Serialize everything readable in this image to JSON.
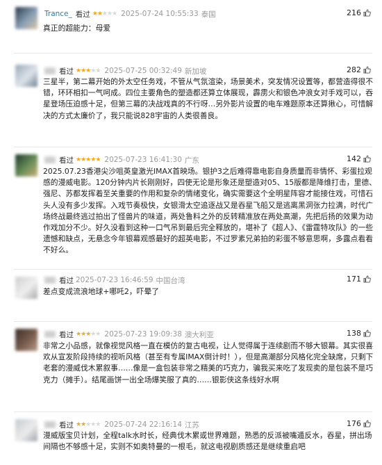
{
  "reviews": [
    {
      "username": "Trance_",
      "username_blurred": false,
      "action": "看过",
      "rating": 2,
      "datetime": "2025-07-24 10:55:33",
      "location": "泰国",
      "votes": "216",
      "text": "真正的超能力：母爱"
    },
    {
      "username": "",
      "username_blurred": true,
      "action": "看过",
      "rating": 3,
      "datetime": "2025-07-25 00:32:49",
      "location": "新加坡",
      "votes": "282",
      "text": "三星半，第二幕开始的外太空任务戏，不管从气氛渲染，场景美术，突发情况设置等，都营造得很不错，环环相扣一气呵成。四位主要角色的塑造都还算立体展现，霹雳火和银色冲浪女对手戏可以，吞星登场压迫感十足，但第三幕的决战戏真的不行呀…另外影片设置的电车难题原本还算揪心，可惜解决的方式太廉价了，我只能说828宇宙的人类很善良。"
    },
    {
      "username": "",
      "username_blurred": true,
      "action": "看过",
      "rating": 5,
      "datetime": "2025-07-23 16:41:30",
      "location": "广东",
      "votes": "142",
      "text": "2025.07.23香港尖沙咀英皇激光IMAX首映场。银护3之后难得靠电影自身质量而非情怀、彩蛋拉观感的漫威电影。120分钟内片长刚刚好，四使无论是形象还是塑造对05、15版都是降维打击，里德、强尼、苏都发挥着至关重要的作用和复杂的情绪变化，确实需要这个全明星阵容才能接住戏，可惜石头人没有多少发挥。入戏节奏极快，女银滑太空追逐战又是吞星飞船又是逃离黑洞张力拉满，时代广场终战最终逃过拍出了怪兽片的味道，两处鲁料之外的反转精准放在两处高潮，先把后扬的效果为动作戏加分不少。好久没看到这种一口气吊到最后完全释放的，堪补了《超人》、《雷霆特攻队》的一些遗憾和缺点，无悬念今年银幕观感最好的超英电影，不过罗素兄弟拍的彩蛋不够意思啊，多露点看看不好么。"
    },
    {
      "username": "",
      "username_blurred": true,
      "action": "看过",
      "rating": 0,
      "datetime": "2025-07-23 16:46:59",
      "location": "中国台湾",
      "votes": "171",
      "text": "差点变成流浪地球+哪吒2，吓晕了"
    },
    {
      "username": "",
      "username_blurred": true,
      "action": "看过",
      "rating": 3,
      "datetime": "2025-07-23 19:09:38",
      "location": "澳大利亚",
      "votes": "138",
      "text": "非常之小品感，就像视觉风格一直在模仿的复古电视，让人觉得属于连续剧而不够大银幕。其实很喜欢从宣发阶段持续的视听风格（甚至有专属IMAX倒计时！），但是高潮部分风格化完全缺席，只剩下老套的漫威伐木累叙事……像是一盒包装非常之精美的巧克力，骗我买来吃了发现卖的是包装不是巧克力（摊手）。结尾画饼一出全场爆笑服了真的……银影侠这条线好水啊"
    },
    {
      "username": "",
      "username_blurred": true,
      "action": "看过",
      "rating": 2,
      "datetime": "2025-07-24 22:16:14",
      "location": "江苏",
      "votes": "176",
      "text": "漫威版宝贝计划，全程talk水时长，经典伐木累或世界难题，熟悉的反派被嘴遁反水，吞星，拼出场间隔也不够感十足，实则不如奥特曼的一根毛，就这电视剧质感还是继续重启吧"
    }
  ]
}
